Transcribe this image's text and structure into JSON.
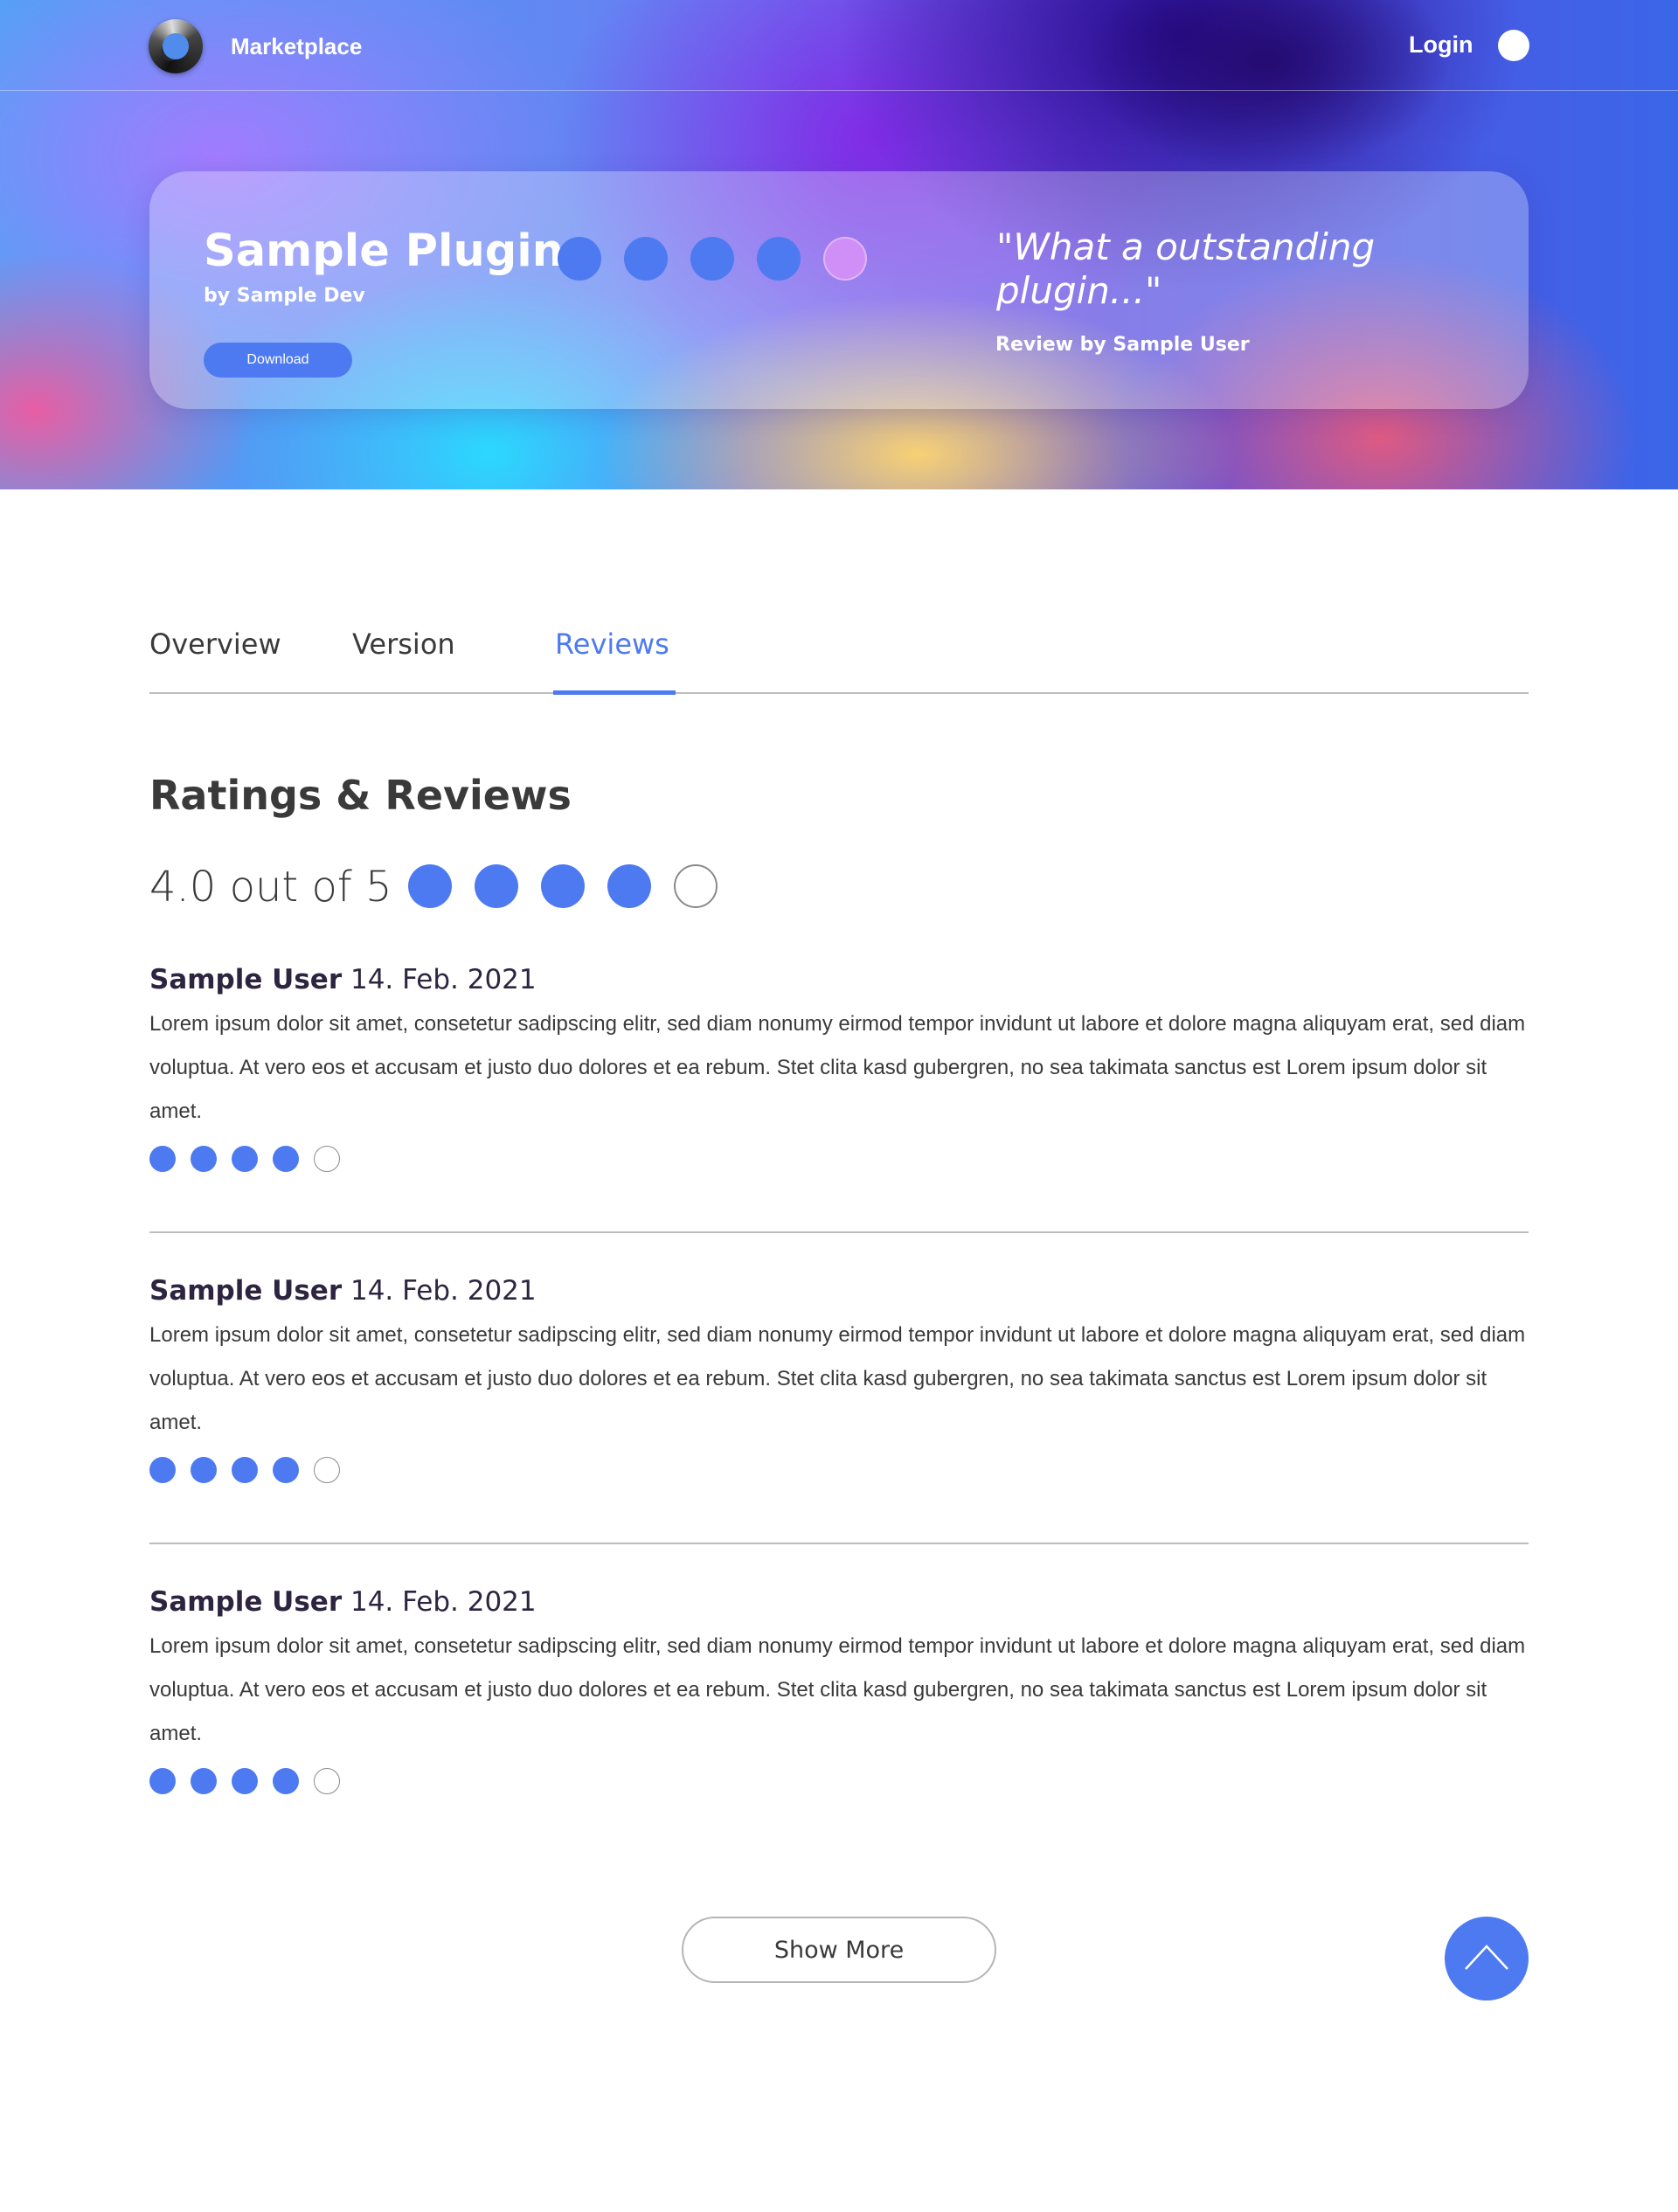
{
  "nav": {
    "brand": "Marketplace",
    "login": "Login",
    "logo_icon": "marketplace-logo",
    "avatar_icon": "user-avatar"
  },
  "hero": {
    "title": "Sample Plugin",
    "author": "by Sample Dev",
    "download_label": "Download",
    "rating": 4,
    "rating_max": 5,
    "quote": "\"What a outstanding plugin...\"",
    "quote_by": "Review by Sample User"
  },
  "tabs": [
    {
      "label": "Overview",
      "active": false
    },
    {
      "label": "Version",
      "active": false
    },
    {
      "label": "Reviews",
      "active": true
    }
  ],
  "ratings": {
    "title": "Ratings & Reviews",
    "summary": "4.0 out of 5",
    "rating": 4,
    "rating_max": 5
  },
  "reviews": [
    {
      "user": "Sample User",
      "date": "14. Feb. 2021",
      "text": "Lorem ipsum dolor sit amet, consetetur sadipscing elitr, sed diam nonumy eirmod tempor invidunt ut labore et dolore magna aliquyam erat, sed diam voluptua. At vero eos et accusam et justo duo dolores et ea rebum. Stet clita kasd gubergren, no sea takimata sanctus est Lorem ipsum dolor sit amet.",
      "rating": 4
    },
    {
      "user": "Sample User",
      "date": "14. Feb. 2021",
      "text": "Lorem ipsum dolor sit amet, consetetur sadipscing elitr, sed diam nonumy eirmod tempor invidunt ut labore et dolore magna aliquyam erat, sed diam voluptua. At vero eos et accusam et justo duo dolores et ea rebum. Stet clita kasd gubergren, no sea takimata sanctus est Lorem ipsum dolor sit amet.",
      "rating": 4
    },
    {
      "user": "Sample User",
      "date": "14. Feb. 2021",
      "text": "Lorem ipsum dolor sit amet, consetetur sadipscing elitr, sed diam nonumy eirmod tempor invidunt ut labore et dolore magna aliquyam erat, sed diam voluptua. At vero eos et accusam et justo duo dolores et ea rebum. Stet clita kasd gubergren, no sea takimata sanctus est Lorem ipsum dolor sit amet.",
      "rating": 4
    }
  ],
  "show_more_label": "Show More",
  "scroll_top_icon": "chevron-up-icon",
  "colors": {
    "accent": "#4d7af0",
    "text": "#3a3a3a",
    "divider": "#bdbdbd"
  }
}
